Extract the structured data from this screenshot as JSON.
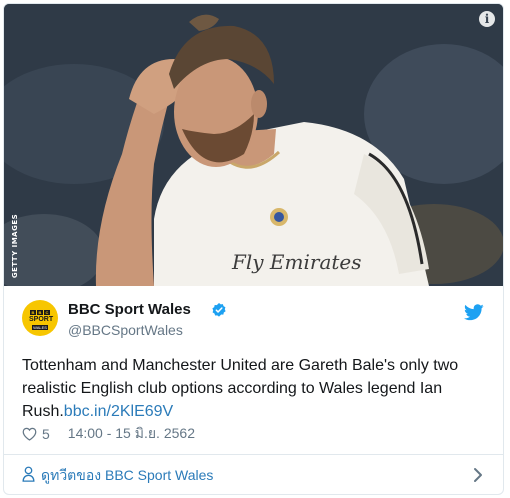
{
  "media": {
    "credit": "GETTY IMAGES",
    "info_icon": "info-icon",
    "jersey_text": "Fly Emirates"
  },
  "author": {
    "name": "BBC Sport Wales",
    "handle": "@BBCSportWales",
    "avatar": {
      "bbc_letters": [
        "B",
        "B",
        "C"
      ],
      "sport": "SPORT",
      "wales": "WALES"
    },
    "verified_icon": "verified-badge-icon",
    "brand_icon": "twitter-bird-icon"
  },
  "tweet": {
    "text": "Tottenham and Manchester United are Gareth Bale's only two realistic English club options according to Wales legend Ian Rush.",
    "link": "bbc.in/2KlE69V"
  },
  "meta": {
    "likes": "5",
    "timestamp": "14:00 - 15 มิ.ย. 2562"
  },
  "footer": {
    "label": "ดูทวีตของ BBC Sport Wales"
  },
  "colors": {
    "link": "#2b7bb9",
    "secondary_text": "#657786",
    "twitter_blue": "#1da1f2",
    "bbc_yellow": "#f7c600"
  }
}
